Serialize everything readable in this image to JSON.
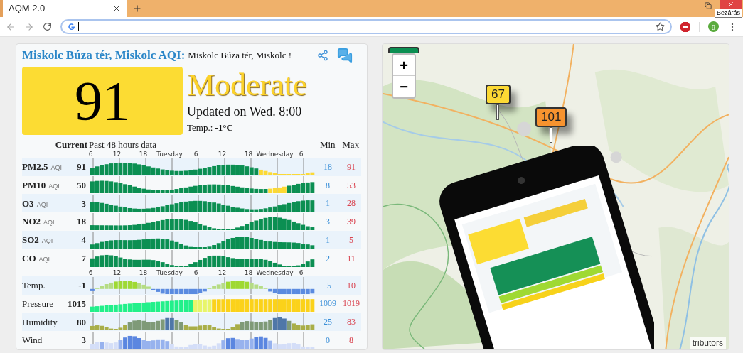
{
  "browser": {
    "tab": {
      "title": "AQM 2.0",
      "selected": true
    },
    "tooltip": "Bezárás",
    "profile_initial": "g"
  },
  "station": {
    "title": "Miskolc Búza tér, Miskolc AQI:",
    "subtitle": "Miskolc Búza tér, Miskolc !",
    "aqi": "91",
    "category": "Moderate",
    "updated": "Updated on Wed. 8:00",
    "temperature": "Temp.: **-1°C**"
  },
  "table": {
    "headers": {
      "current": "Current",
      "history": "Past 48 hours data",
      "min": "Min",
      "max": "Max"
    },
    "rows": [
      {
        "kind": "axis",
        "labels": [
          "6",
          "12",
          "18",
          "Tuesday",
          "6",
          "12",
          "18",
          "Wednesday",
          "6"
        ]
      },
      {
        "kind": "aqi",
        "label": "PM2.5",
        "unit": "AQI",
        "current": "91",
        "min": "18",
        "max": "91"
      },
      {
        "kind": "aqi",
        "label": "PM10",
        "unit": "AQI",
        "current": "50",
        "min": "8",
        "max": "53"
      },
      {
        "kind": "aqi",
        "label": "O3",
        "unit": "AQI",
        "current": "3",
        "min": "1",
        "max": "28"
      },
      {
        "kind": "aqi",
        "label": "NO2",
        "unit": "AQI",
        "current": "18",
        "min": "3",
        "max": "39"
      },
      {
        "kind": "aqi",
        "label": "SO2",
        "unit": "AQI",
        "current": "4",
        "min": "1",
        "max": "5"
      },
      {
        "kind": "aqi",
        "label": "CO",
        "unit": "AQI",
        "current": "7",
        "min": "2",
        "max": "11"
      },
      {
        "kind": "axis",
        "labels": [
          "6",
          "12",
          "18",
          "Tuesday",
          "6",
          "12",
          "18",
          "Wednesday",
          "6"
        ]
      },
      {
        "kind": "temp",
        "label": "Temp.",
        "current": "-1",
        "min": "-5",
        "max": "10"
      },
      {
        "kind": "pressure",
        "label": "Pressure",
        "current": "1015",
        "min": "1009",
        "max": "1019"
      },
      {
        "kind": "humidity",
        "label": "Humidity",
        "current": "80",
        "min": "25",
        "max": "83"
      },
      {
        "kind": "wind",
        "label": "Wind",
        "current": "3",
        "min": "0",
        "max": "8"
      }
    ]
  },
  "map": {
    "zoom": [
      "+",
      "−"
    ],
    "markers": [
      {
        "value": "67",
        "color": "#fcd934"
      },
      {
        "value": "101",
        "color": "#f7932f"
      }
    ],
    "attribution": "tributors"
  }
}
